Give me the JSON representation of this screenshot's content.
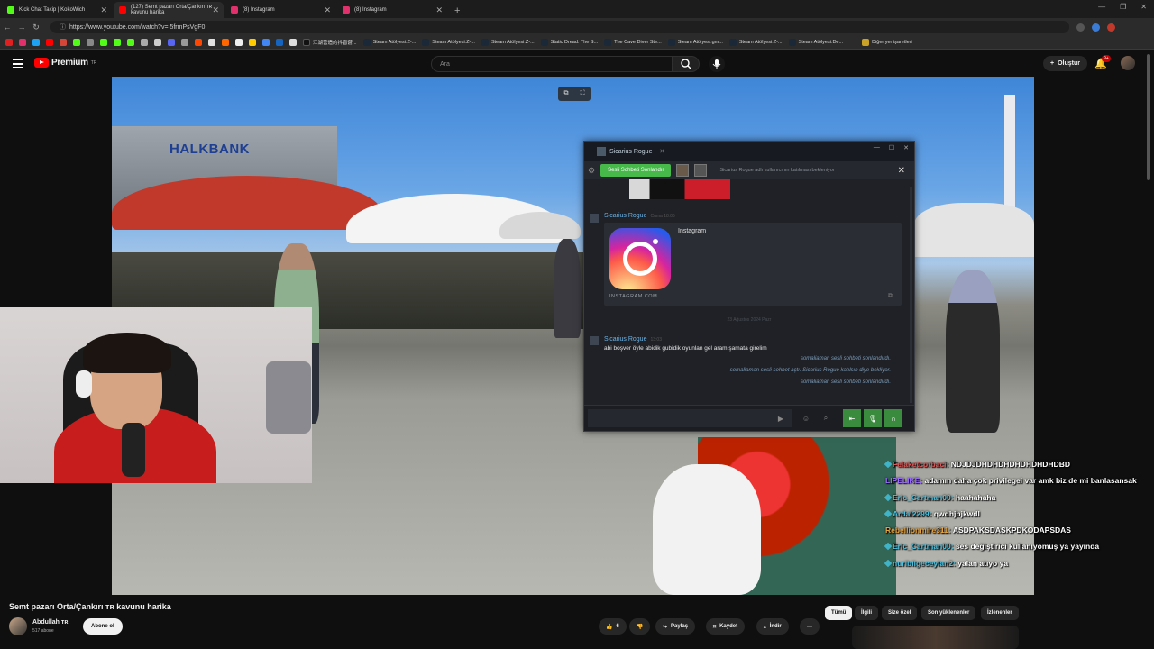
{
  "browser": {
    "tabs": [
      {
        "title": "Kick Chat Takip | KokoWich",
        "icon_color": "#53fc18"
      },
      {
        "title": "(127) Semt pazarı Orta/Çankırı ᴛʀ kavunu harika",
        "icon_color": "#ff0000"
      },
      {
        "title": "(8) Instagram",
        "icon_color": "#e1306c"
      },
      {
        "title": "(8) Instagram",
        "icon_color": "#e1306c"
      }
    ],
    "active_tab": 1,
    "url": "https://www.youtube.com/watch?v=I5frmPsVgF0",
    "bookmarks": [
      "江湖营造的抖音蒼...",
      "Steam Atölyesi:Z-...",
      "Steam Atölyesi:Z-...",
      "Steam Atölyesi:Z-...",
      "Static Dread: The S...",
      "The Cave Diver Ste...",
      "Steam Atölyesi:gm...",
      "Steam Atölyesi:Z-...",
      "Steam Atölyesi:De..."
    ],
    "other_bookmarks": "Diğer yer işaretleri"
  },
  "youtube": {
    "logo": "Premium",
    "logo_region": "TR",
    "search_placeholder": "Ara",
    "create_label": "Oluştur",
    "notification_count": "9+",
    "video_title": "Semt pazarı Orta/Çankırı ᴛʀ kavunu harika",
    "channel_name": "Abdullah ᴛʀ",
    "subscribers": "517 abone",
    "subscribe_label": "Abone ol",
    "like_count": "6",
    "share_label": "Paylaş",
    "save_label": "Kaydet",
    "download_label": "İndir",
    "chips": [
      "Tümü",
      "İlgili",
      "Size özel",
      "Son yüklenenler",
      "İzlenenler"
    ]
  },
  "video_scene": {
    "bank_sign": "HALKBANK"
  },
  "steam_chat": {
    "contact": "Sicarius Rogue",
    "voice_button": "Sesli Sohbeti Sonlandır",
    "waiting_text": "Sicarius Rogue adlı kullanıcının katılması bekleniyor",
    "messages": {
      "sender1": "Sicarius Rogue",
      "time1": "Cuma 18:06",
      "card_title": "Instagram",
      "card_domain": "INSTAGRAM.COM",
      "date_separator": "23 Ağustos 2024 Pazr",
      "sender2": "Sicarius Rogue",
      "time2": "13:03",
      "text": "abi boşver öyle abidik gubidik oyunlan gel aram şamata girelim",
      "system": [
        "somaliaman sesli sohbeti sonlandırdı.",
        "somaliaman sesli sohbet açtı. Sicarius Rogue katılsın diye bekliyor.",
        "somaliaman sesli sohbeti sonlandırdı."
      ]
    }
  },
  "live_chat": [
    {
      "user": "Felaketcorbaci:",
      "msg": "NDJDJDHDHDHDHDHDHDHDBD",
      "color": "#e05555"
    },
    {
      "user": "LIPELIKE:",
      "msg": "adamın daha çok privilegei var amk biz de mi banlasansak",
      "color": "#9b6cff"
    },
    {
      "user": "Eric_Cartman00:",
      "msg": "haahahaha",
      "color": "#4ac1e0"
    },
    {
      "user": "Ardal2299:",
      "msg": "qwdhjbjkwdl",
      "color": "#4ac1e0"
    },
    {
      "user": "Rebellionmire311:",
      "msg": "ASDPAKSDASKPDKODAPSDAS",
      "color": "#e6a23c"
    },
    {
      "user": "Eric_Cartman00:",
      "msg": "ses değiştirici kullanıyomuş ya yayında",
      "color": "#4ac1e0"
    },
    {
      "user": "nuribilgeceylan2:",
      "msg": "yalan atıyo ya",
      "color": "#4ac1e0"
    }
  ]
}
